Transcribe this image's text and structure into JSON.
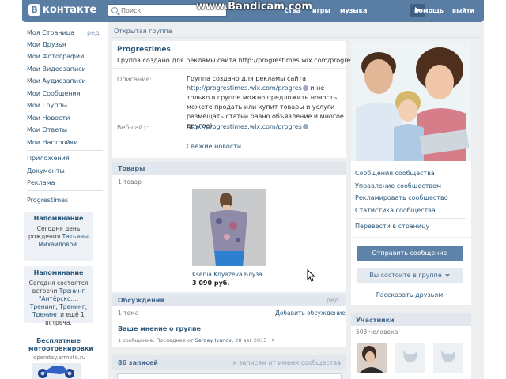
{
  "header": {
    "logo_text": "контакте",
    "logo_letter": "В",
    "search_placeholder": "Поиск",
    "watermark": "www.Bandicam.com",
    "nav": {
      "people": "ства",
      "games": "игры",
      "music": "музыка",
      "help": "помощь",
      "logout": "выйти"
    }
  },
  "sidebar": {
    "items": [
      {
        "label": "Моя Страница"
      },
      {
        "label": "Мои Друзья"
      },
      {
        "label": "Мои Фотографии"
      },
      {
        "label": "Мои Видеозаписи"
      },
      {
        "label": "Мои Аудиозаписи"
      },
      {
        "label": "Мои Сообщения"
      },
      {
        "label": "Мои Группы"
      },
      {
        "label": "Мои Новости"
      },
      {
        "label": "Мои Ответы"
      },
      {
        "label": "Мои Настройки"
      }
    ],
    "edit_label": "ред.",
    "extra": [
      {
        "label": "Приложения"
      },
      {
        "label": "Документы"
      },
      {
        "label": "Реклама"
      }
    ],
    "bookmark": "Progrestimes",
    "notice1": {
      "title": "Напоминание",
      "body_prefix": "Сегодня день рождения ",
      "body_link": "Татьяны Михайловой",
      "body_suffix": "."
    },
    "notice2": {
      "title": "Напоминание",
      "body_prefix": "Сегодня состоятся встречи ",
      "body_link": "Тренинг \"Антёрско..., Тренинг, Тренинг, Тренинг",
      "body_suffix": " и ещё 1 встреча."
    },
    "ad": {
      "title": "Бесплатные мотоотренировки",
      "site": "openday.armoto.ru"
    }
  },
  "main": {
    "breadcrumb": "Открытая группа",
    "group": {
      "name": "Progrestimes",
      "status": "Группа создано для рекламы сайта http://progrestimes.wix.com/progres",
      "description_label": "Описание:",
      "description_line1": "Группа создано для рекламы сайта",
      "description_link": "http://progrestimes.wix.com/progres",
      "description_rest": " и не только в группе можно предложить новость можете продать или купит товары и услуги размещать статьи равно объявление и многое другое)",
      "website_label": "Веб-сайт:",
      "website_link": "http://progrestimes.wix.com/progres",
      "fresh_news": "Свежие новости"
    },
    "goods": {
      "title": "Товары",
      "count": "1 товар",
      "product_name": "Ksenia Knyazeva Блуза",
      "product_price": "3 090 руб."
    },
    "discussions": {
      "title": "Обсуждения",
      "edit": "ред.",
      "count": "1 тема",
      "add": "Добавить обсуждение",
      "topic": "Ваше мнение о группе",
      "meta_prefix": "1 сообщение. Последнее от ",
      "meta_author": "Sergey Ivanov",
      "meta_date": ", 28 авг 2015",
      "arrow": "→"
    },
    "posts": {
      "count": "86 записей",
      "to_community": "к записям от имени сообщества"
    }
  },
  "right": {
    "links": [
      {
        "label": "Сообщения сообщества"
      },
      {
        "label": "Управление сообществом"
      },
      {
        "label": "Рекламировать сообщество"
      },
      {
        "label": "Статистика сообщества"
      }
    ],
    "to_page": "Перевести в страницу",
    "send_message": "Отправить сообщение",
    "member_status": "Вы состоите в группе",
    "tell_friends": "Рассказать друзьям",
    "members_title": "Участники",
    "members_count": "503 человека"
  }
}
